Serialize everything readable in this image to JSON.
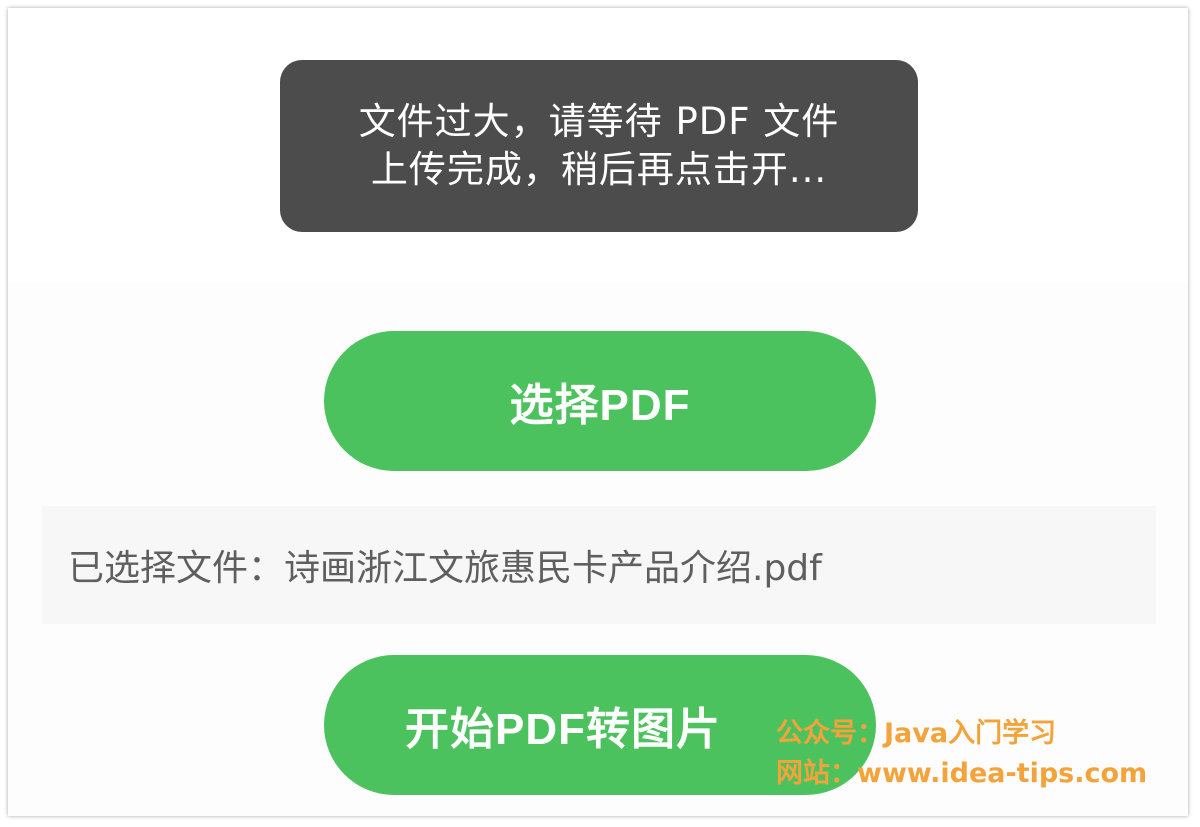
{
  "toast": {
    "line1": "文件过大，请等待 PDF 文件",
    "line2": "上传完成，稍后再点击开..."
  },
  "select_button": {
    "label": "选择PDF"
  },
  "selected_file": {
    "text": "已选择文件：诗画浙江文旅惠民卡产品介绍.pdf"
  },
  "convert_button": {
    "label": "开始PDF转图片"
  },
  "watermark": {
    "line1": "公众号：Java入门学习",
    "line2": "网站：www.idea-tips.com"
  },
  "colors": {
    "accent_green": "#4cc25e",
    "toast_bg": "#4c4c4c",
    "watermark": "#f3a33a"
  }
}
